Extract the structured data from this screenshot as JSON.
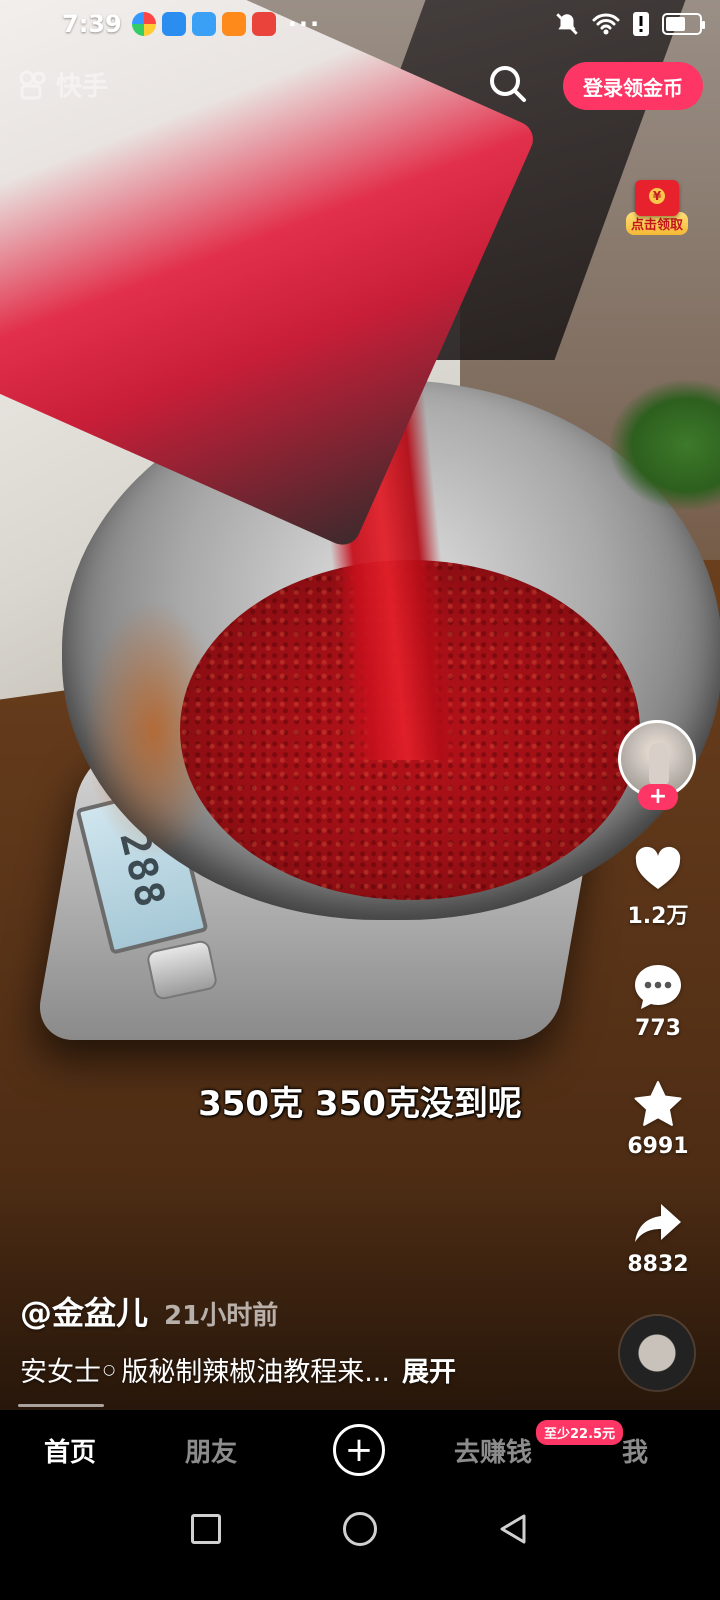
{
  "status_bar": {
    "time": "7:39",
    "more_indicator": "···"
  },
  "top": {
    "watermark": "快手",
    "login_label": "登录领金币",
    "red_packet_label": "点击领取"
  },
  "video": {
    "scale_reading": "288",
    "subtitle": "350克 350克没到呢"
  },
  "actions": {
    "follow_symbol": "+",
    "likes": "1.2万",
    "comments": "773",
    "favorites": "6991",
    "shares": "8832"
  },
  "post": {
    "author": "@金盆儿",
    "time_ago": "21小时前",
    "description_prefix": "安女士",
    "description_rest": "版秘制辣椒油教程来...",
    "expand_label": "展开"
  },
  "tabbar": {
    "tabs": [
      {
        "label": "首页",
        "active": true
      },
      {
        "label": "朋友",
        "active": false
      },
      {
        "label": "去赚钱",
        "active": false
      },
      {
        "label": "我",
        "active": false
      }
    ],
    "add_symbol": "+",
    "earn_badge": "至少22.5元"
  },
  "colors": {
    "accent": "#fe3666"
  },
  "icons": {
    "search": "search-icon",
    "like": "heart-icon",
    "comment": "comment-icon",
    "favorite": "star-icon",
    "share": "share-icon"
  }
}
